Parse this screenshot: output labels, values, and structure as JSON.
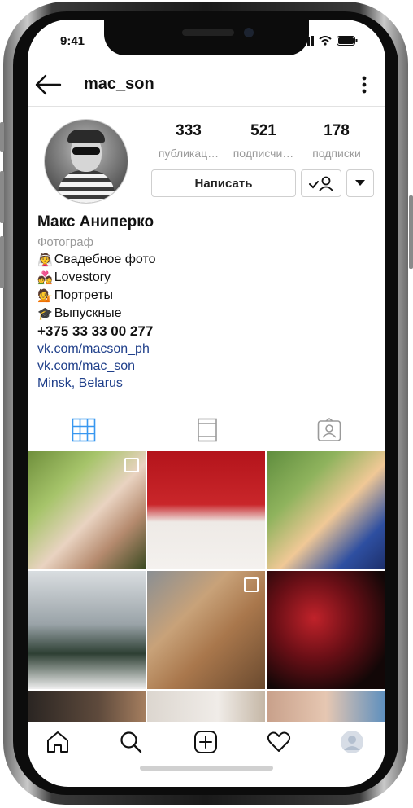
{
  "status_bar": {
    "time": "9:41"
  },
  "header": {
    "username": "mac_son"
  },
  "profile": {
    "stats": [
      {
        "count": "333",
        "label": "публикац…"
      },
      {
        "count": "521",
        "label": "подписчи…"
      },
      {
        "count": "178",
        "label": "подписки"
      }
    ],
    "message_button": "Написать",
    "name": "Макс Аниперко",
    "category": "Фотограф",
    "bio_lines": [
      {
        "emoji": "👰",
        "text": "Свадебное фото"
      },
      {
        "emoji": "💑",
        "text": "Lovestory"
      },
      {
        "emoji": "💁",
        "text": "Портреты"
      },
      {
        "emoji": "🎓",
        "text": "Выпускные"
      }
    ],
    "phone": "+375 33 33 00 277",
    "links": [
      "vk.com/macson_ph",
      "vk.com/mac_son"
    ],
    "location": "Minsk, Belarus"
  },
  "tabs": [
    "grid-icon",
    "feed-icon",
    "tagged-icon"
  ],
  "grid_photos": [
    {
      "subject": "wedding rings hands with bouquet",
      "multiple": true
    },
    {
      "subject": "three brides on red background",
      "multiple": false
    },
    {
      "subject": "girls with red passports selfie",
      "multiple": false
    },
    {
      "subject": "couple in snowy park",
      "multiple": false
    },
    {
      "subject": "couple near log pile",
      "multiple": true
    },
    {
      "subject": "couple in red light",
      "multiple": false
    },
    {
      "subject": "man in bar",
      "multiple": false
    },
    {
      "subject": "bride with flowers",
      "multiple": false
    },
    {
      "subject": "couple portrait",
      "multiple": false
    }
  ],
  "bottom_nav": [
    "home-icon",
    "search-icon",
    "new-post-icon",
    "activity-icon",
    "profile-icon"
  ],
  "colors": {
    "link": "#1f3f8a",
    "accent_blue": "#3897f0",
    "secondary_text": "#9a9a9a"
  }
}
